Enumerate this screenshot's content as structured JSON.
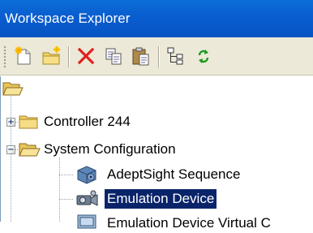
{
  "window": {
    "title": "Workspace Explorer"
  },
  "toolbar": {
    "buttons": [
      {
        "name": "new-file",
        "icon": "new-file-icon"
      },
      {
        "name": "new-folder",
        "icon": "new-folder-icon"
      },
      {
        "name": "delete",
        "icon": "delete-x-icon",
        "color": "#e02020"
      },
      {
        "name": "copy",
        "icon": "copy-icon"
      },
      {
        "name": "paste",
        "icon": "paste-icon"
      },
      {
        "name": "tree-view",
        "icon": "tree-structure-icon"
      },
      {
        "name": "refresh",
        "icon": "refresh-icon",
        "color": "#1a9a1a"
      }
    ]
  },
  "tree": {
    "selected_color": "#0a246a",
    "nodes": [
      {
        "label": "",
        "icon": "folder-open-icon",
        "expanded": true
      },
      {
        "label": "Controller 244",
        "icon": "folder-icon",
        "expanded": false
      },
      {
        "label": "System Configuration",
        "icon": "folder-open-icon",
        "expanded": true
      },
      {
        "label": "AdeptSight Sequence",
        "icon": "sequence-icon"
      },
      {
        "label": "Emulation Device",
        "icon": "camera-device-icon",
        "selected": true
      },
      {
        "label": "Emulation Device Virtual C",
        "icon": "virtual-camera-icon"
      }
    ]
  }
}
